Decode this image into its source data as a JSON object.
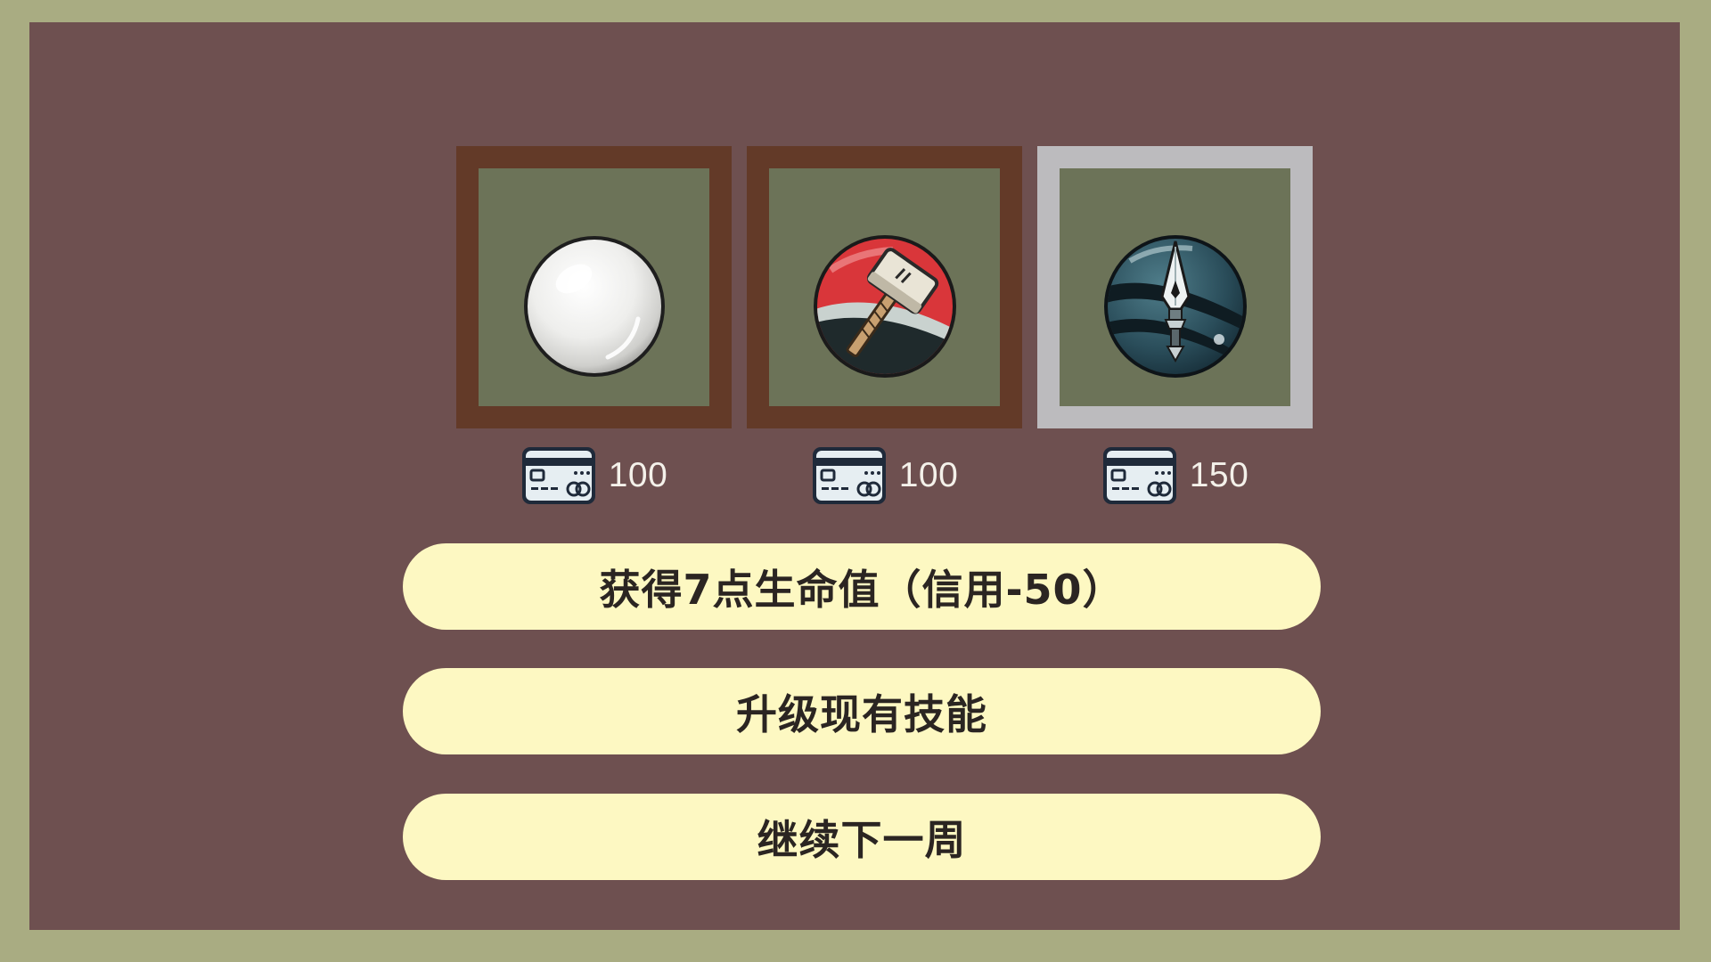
{
  "shop": {
    "items": [
      {
        "icon": "white-orb-icon",
        "price": "100",
        "selected": false
      },
      {
        "icon": "hammer-orb-icon",
        "price": "100",
        "selected": false
      },
      {
        "icon": "spear-orb-icon",
        "price": "150",
        "selected": true
      }
    ],
    "currency_icon": "credit-card-icon"
  },
  "actions": {
    "heal_label": "获得7点生命值（信用-50）",
    "upgrade_label": "升级现有技能",
    "continue_label": "继续下一周"
  },
  "colors": {
    "outer_frame": "#a9ac82",
    "panel": "#6e5050",
    "item_border": "#633a28",
    "item_border_selected": "#bcbbbe",
    "item_background": "#6c7358",
    "button_background": "#fdf8c2",
    "button_text": "#2b2522",
    "price_text": "#f4f1ea"
  }
}
